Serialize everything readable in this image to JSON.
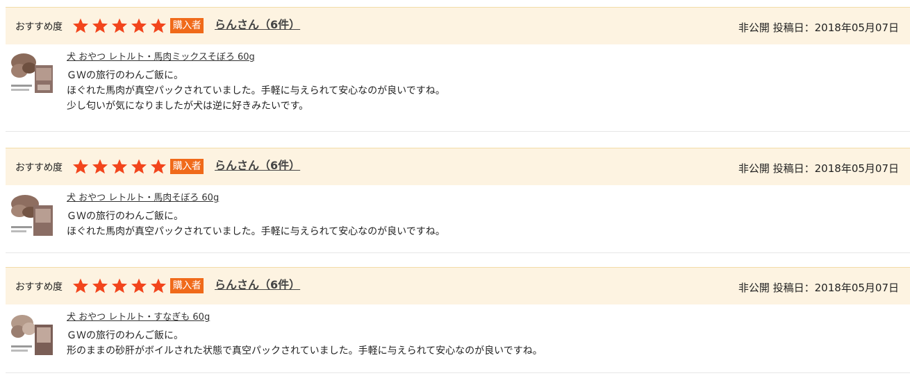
{
  "reviews": [
    {
      "recommend_label": "おすすめ度",
      "rating": 5,
      "buyer_badge": "購入者",
      "reviewer": "らんさん（6件）",
      "meta": "非公開 投稿日：2018年05月07日",
      "product": "犬 おやつ レトルト・馬肉ミックスそぼろ 60g",
      "lines": [
        "ＧＷの旅行のわんご飯に。",
        "ほぐれた馬肉が真空パックされていました。手軽に与えられて安心なのが良いですね。",
        "少し匂いが気になりましたが犬は逆に好きみたいです。"
      ]
    },
    {
      "recommend_label": "おすすめ度",
      "rating": 5,
      "buyer_badge": "購入者",
      "reviewer": "らんさん（6件）",
      "meta": "非公開 投稿日：2018年05月07日",
      "product": "犬 おやつ レトルト・馬肉そぼろ 60g",
      "lines": [
        "ＧＷの旅行のわんご飯に。",
        "ほぐれた馬肉が真空パックされていました。手軽に与えられて安心なのが良いですね。"
      ]
    },
    {
      "recommend_label": "おすすめ度",
      "rating": 5,
      "buyer_badge": "購入者",
      "reviewer": "らんさん（6件）",
      "meta": "非公開 投稿日：2018年05月07日",
      "product": "犬 おやつ レトルト・すなぎも 60g",
      "lines": [
        "ＧＷの旅行のわんご飯に。",
        "形のままの砂肝がボイルされた状態で真空パックされていました。手軽に与えられて安心なのが良いですね。"
      ]
    }
  ],
  "colors": {
    "star": "#f2451c",
    "badge": "#f06a1a",
    "header_bg": "#fdf3e1"
  },
  "icons": {
    "star": "star-icon",
    "product_image": "product-thumbnail"
  }
}
